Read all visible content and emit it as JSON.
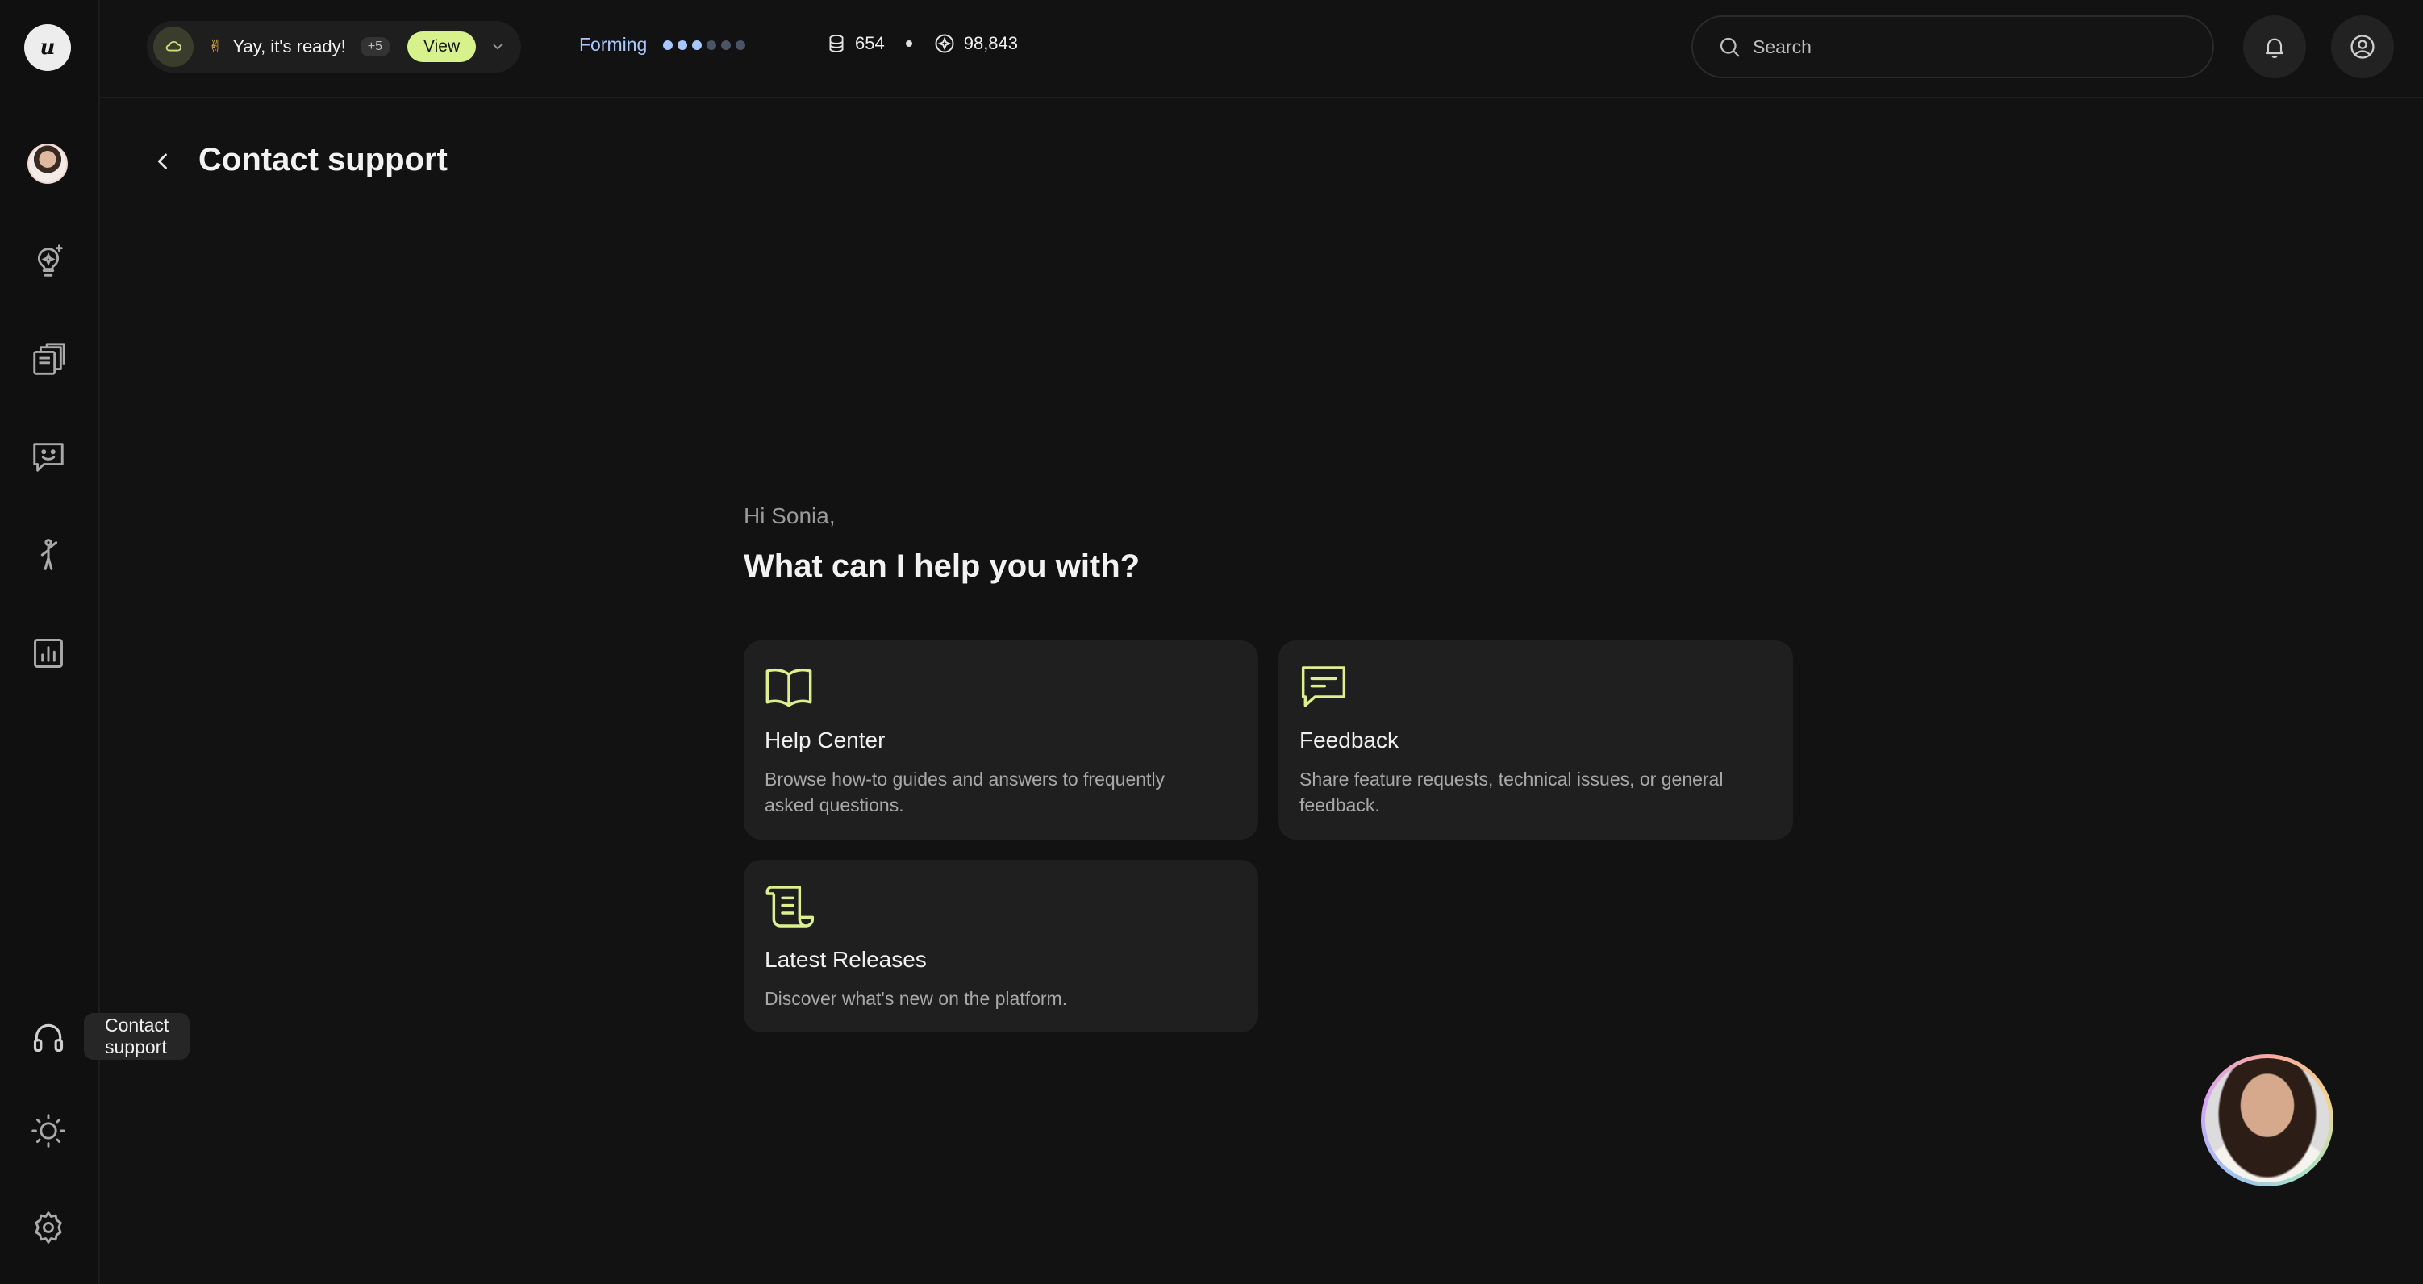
{
  "sidebar": {
    "logo_text": "u",
    "icons": [
      "avatar",
      "idea-bulb-icon",
      "library-icon",
      "feedback-chat-icon",
      "person-icon",
      "analytics-icon",
      "headset-icon",
      "theme-sun-icon",
      "settings-gear-icon"
    ],
    "tooltip": "Contact support"
  },
  "topbar": {
    "notification": {
      "emoji": "✌",
      "text": "Yay, it's ready!",
      "count": "+5",
      "view_label": "View"
    },
    "forming": {
      "label": "Forming",
      "progress_filled": 3,
      "progress_total": 6
    },
    "stats": {
      "first_value": "654",
      "second_value": "98,843"
    },
    "search_placeholder": "Search"
  },
  "header": {
    "title": "Contact support"
  },
  "main": {
    "greeting": "Hi Sonia,",
    "question": "What can I help you with?",
    "cards": [
      {
        "title": "Help Center",
        "description": "Browse how-to guides and answers to frequently asked questions.",
        "icon": "book-icon"
      },
      {
        "title": "Feedback",
        "description": "Share feature requests, technical issues, or general feedback.",
        "icon": "message-icon"
      },
      {
        "title": "Latest Releases",
        "description": "Discover what's new on the platform.",
        "icon": "scroll-icon"
      }
    ]
  },
  "colors": {
    "accent": "#d7f28a",
    "forming": "#a9c7ff",
    "background": "#121212",
    "card": "#1f1f1f"
  }
}
